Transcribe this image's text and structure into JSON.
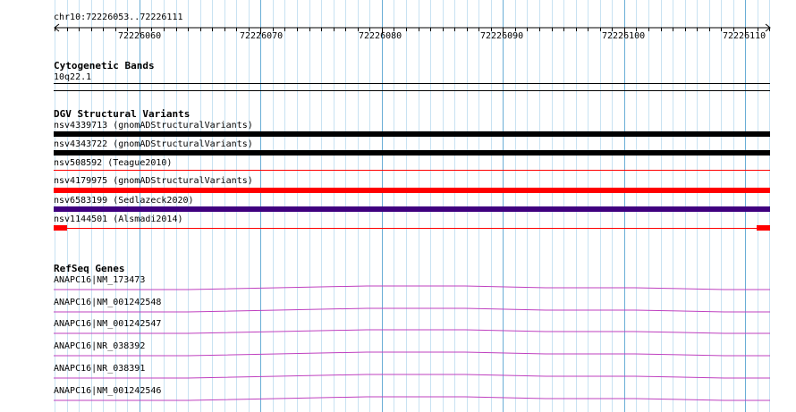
{
  "location": "chr10:72226053..72226111",
  "ruler": {
    "labels": [
      "72226060",
      "72226070",
      "72226080",
      "72226090",
      "72226100",
      "72226110"
    ]
  },
  "tracks": {
    "cytoband": {
      "title": "Cytogenetic Bands",
      "band": "10q22.1"
    },
    "dgv": {
      "title": "DGV Structural Variants",
      "variants": [
        {
          "label": "nsv4339713 (gnomADStructuralVariants)",
          "color": "#000000",
          "style": "thick"
        },
        {
          "label": "nsv4343722 (gnomADStructuralVariants)",
          "color": "#000000",
          "style": "thick"
        },
        {
          "label": "nsv508592 (Teague2010)",
          "color": "#ff0000",
          "style": "thin"
        },
        {
          "label": "nsv4179975 (gnomADStructuralVariants)",
          "color": "#ff0000",
          "style": "thick"
        },
        {
          "label": "nsv6583199 (Sedlazeck2020)",
          "color": "#3f007f",
          "style": "thick"
        },
        {
          "label": "nsv1144501 (Alsmadi2014)",
          "color": "#ff0000",
          "style": "thin-capped"
        }
      ]
    },
    "refseq": {
      "title": "RefSeq Genes",
      "color": "#bf40bf",
      "genes": [
        "ANAPC16|NM_173473",
        "ANAPC16|NM_001242548",
        "ANAPC16|NM_001242547",
        "ANAPC16|NR_038392",
        "ANAPC16|NR_038391",
        "ANAPC16|NM_001242546"
      ]
    }
  }
}
